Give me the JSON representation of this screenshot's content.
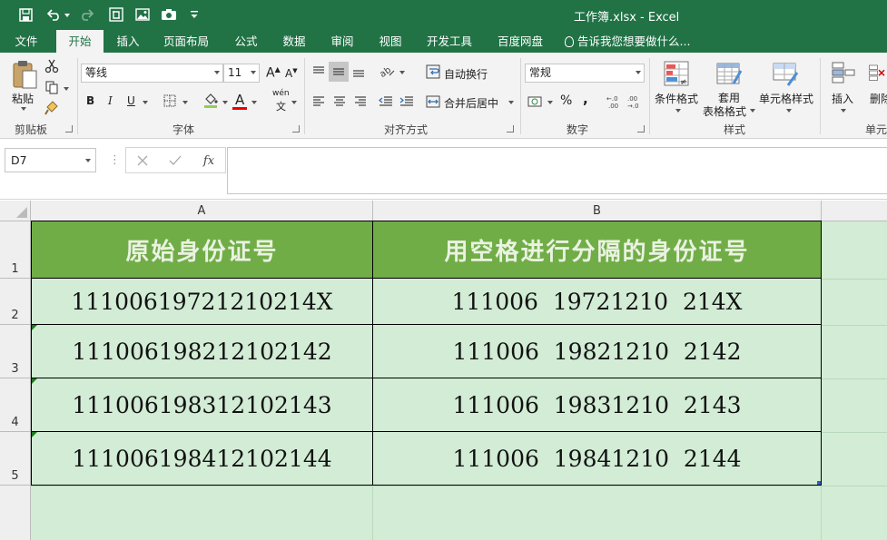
{
  "window": {
    "title": "工作簿.xlsx - Excel"
  },
  "tabs": [
    {
      "label": "文件"
    },
    {
      "label": "开始"
    },
    {
      "label": "插入"
    },
    {
      "label": "页面布局"
    },
    {
      "label": "公式"
    },
    {
      "label": "数据"
    },
    {
      "label": "审阅"
    },
    {
      "label": "视图"
    },
    {
      "label": "开发工具"
    },
    {
      "label": "百度网盘"
    }
  ],
  "tell_me": "告诉我您想要做什么...",
  "ribbon": {
    "clipboard": {
      "paste": "粘贴",
      "group": "剪贴板"
    },
    "font": {
      "name": "等线",
      "size": "11",
      "bold": "B",
      "italic": "I",
      "underline": "U",
      "increase": "A",
      "decrease": "A",
      "phonetic_top": "wén",
      "phonetic_bottom": "文",
      "font_color": "A",
      "group": "字体"
    },
    "alignment": {
      "wrap_text": "自动换行",
      "merge_center": "合并后居中",
      "group": "对齐方式"
    },
    "number": {
      "format": "常规",
      "percent": "%",
      "comma": ",",
      "group": "数字"
    },
    "styles": {
      "conditional": "条件格式",
      "table_line1": "套用",
      "table_line2": "表格格式",
      "cell_styles": "单元格样式",
      "group": "样式"
    },
    "cells": {
      "insert": "插入",
      "delete": "删除",
      "group": "单元"
    }
  },
  "formula_bar": {
    "name_box": "D7",
    "fx": "fx",
    "value": ""
  },
  "sheet": {
    "columns": [
      "A",
      "B"
    ],
    "rows": [
      "1",
      "2",
      "3",
      "4",
      "5"
    ],
    "header": [
      "原始身份证号",
      "用空格进行分隔的身份证号"
    ],
    "data": [
      [
        "11100619721210214X",
        "111006  19721210  214X"
      ],
      [
        "111006198212102142",
        "111006  19821210  2142"
      ],
      [
        "111006198312102143",
        "111006  19831210  2143"
      ],
      [
        "111006198412102144",
        "111006  19841210  2144"
      ]
    ]
  },
  "colors": {
    "accent": "#217346",
    "header_fill": "#71ad47",
    "body_fill": "#d2ecd5"
  }
}
